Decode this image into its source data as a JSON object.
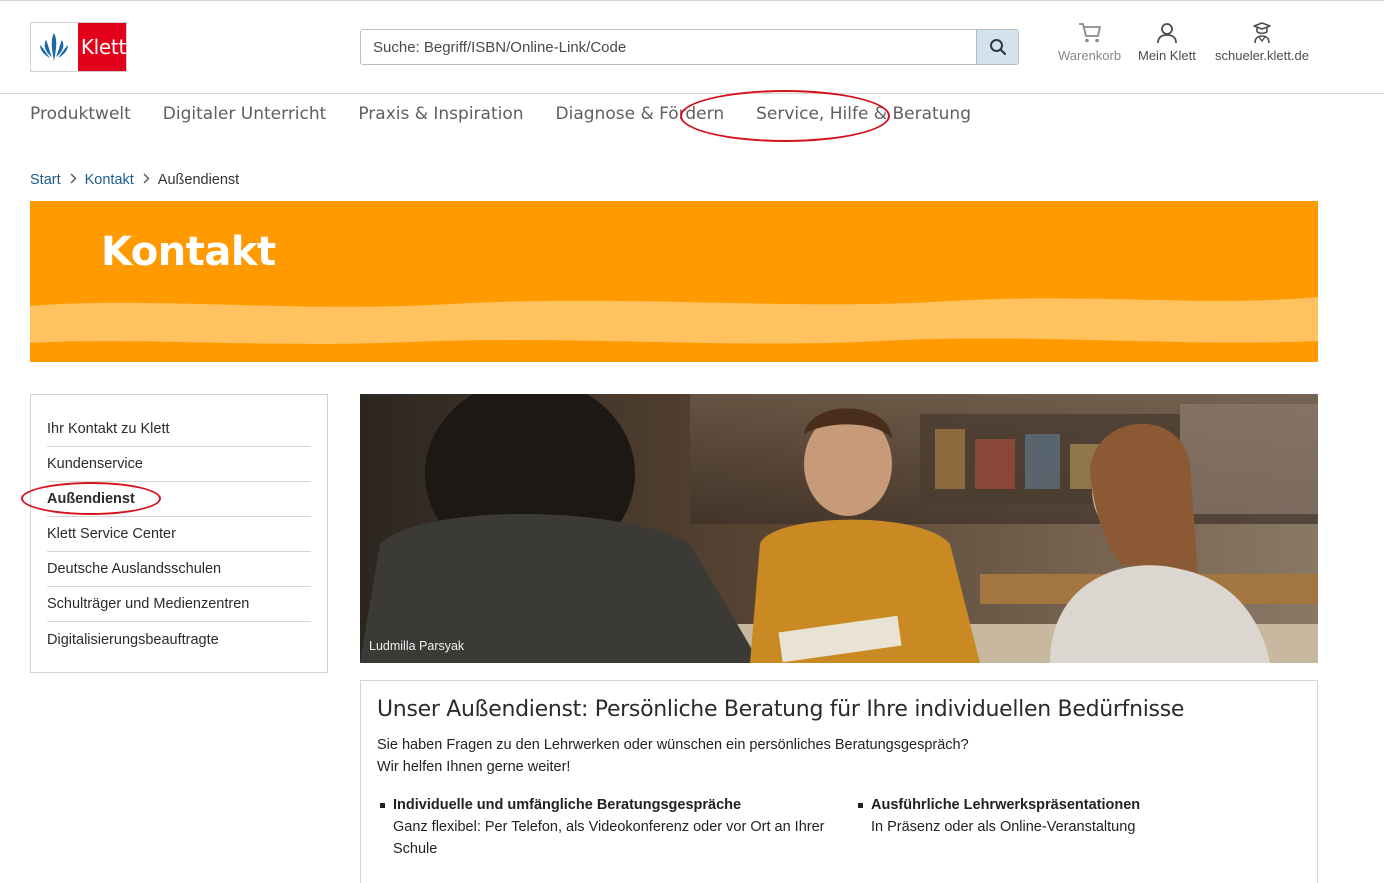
{
  "header": {
    "logo_text": "Klett",
    "search_placeholder": "Suche: Begriff/ISBN/Online-Link/Code",
    "icons": {
      "cart": {
        "label": "Warenkorb",
        "icon": "cart-icon"
      },
      "account": {
        "label": "Mein Klett",
        "icon": "user-icon"
      },
      "student": {
        "label": "schueler.klett.de",
        "icon": "student-icon"
      }
    }
  },
  "mainnav": {
    "items": [
      {
        "label": "Produktwelt"
      },
      {
        "label": "Digitaler Unterricht"
      },
      {
        "label": "Praxis & Inspiration"
      },
      {
        "label": "Diagnose & Fördern"
      },
      {
        "label": "Service, Hilfe & Beratung"
      }
    ],
    "highlighted": "Service, Hilfe & Beratung"
  },
  "breadcrumb": {
    "items": [
      {
        "label": "Start"
      },
      {
        "label": "Kontakt"
      },
      {
        "label": "Außendienst"
      }
    ]
  },
  "banner": {
    "title": "Kontakt"
  },
  "sidenav": {
    "items": [
      {
        "label": "Ihr Kontakt zu Klett"
      },
      {
        "label": "Kundenservice"
      },
      {
        "label": "Außendienst"
      },
      {
        "label": "Klett Service Center"
      },
      {
        "label": "Deutsche Auslandsschulen"
      },
      {
        "label": "Schulträger und Medienzentren"
      },
      {
        "label": "Digitalisierungsbeauftragte"
      }
    ],
    "active": "Außendienst"
  },
  "hero": {
    "credit": "Ludmilla Parsyak"
  },
  "content": {
    "heading": "Unser Außendienst: Persönliche Beratung für Ihre individuellen Bedürfnisse",
    "intro_line1": "Sie haben Fragen zu den Lehrwerken oder wünschen ein persönliches Beratungsgespräch?",
    "intro_line2": "Wir helfen Ihnen gerne weiter!",
    "features": [
      {
        "title": "Individuelle und umfängliche Beratungsgespräche",
        "text": "Ganz flexibel: Per Telefon, als Videokonferenz oder vor Ort an Ihrer Schule"
      },
      {
        "title": "Ausführliche Lehrwerkspräsentationen",
        "text": "In Präsenz oder als Online-Veranstaltung"
      }
    ]
  },
  "colors": {
    "brand_red": "#e2001a",
    "banner_orange": "#ff9a00",
    "link_blue": "#1b5c8d",
    "annotation_red": "#d4121c"
  }
}
